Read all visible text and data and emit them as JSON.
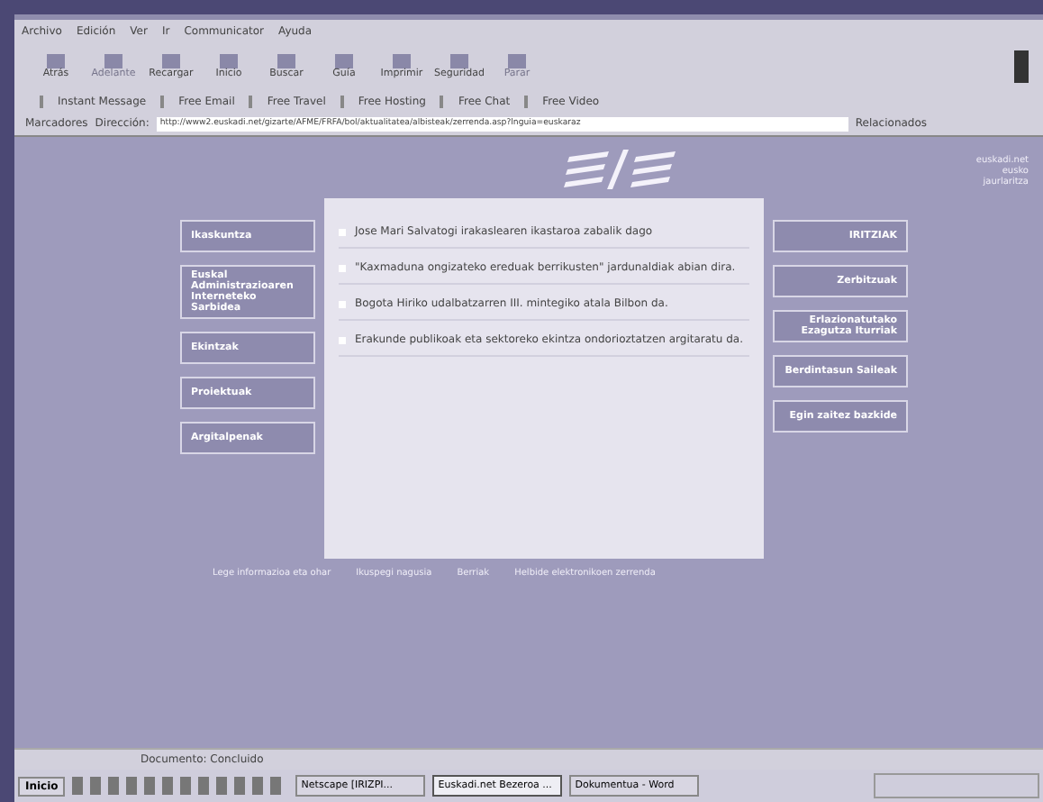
{
  "menu": [
    "Archivo",
    "Edición",
    "Ver",
    "Ir",
    "Communicator",
    "Ayuda"
  ],
  "toolbar": [
    {
      "label": "Atrás",
      "disabled": false
    },
    {
      "label": "Adelante",
      "disabled": true
    },
    {
      "label": "Recargar",
      "disabled": false
    },
    {
      "label": "Inicio",
      "disabled": false
    },
    {
      "label": "Buscar",
      "disabled": false
    },
    {
      "label": "Guía",
      "disabled": false
    },
    {
      "label": "Imprimir",
      "disabled": false
    },
    {
      "label": "Seguridad",
      "disabled": false
    },
    {
      "label": "Parar",
      "disabled": true
    }
  ],
  "personal_bar": [
    "Instant Message",
    "Free Email",
    "Free Travel",
    "Free Hosting",
    "Free Chat",
    "Free Video"
  ],
  "location": {
    "bookmarks": "Marcadores",
    "label": "Dirección:",
    "value": "http://www2.euskadi.net/gizarte/AFME/FRFA/bol/aktualitatea/albisteak/zerrenda.asp?lnguia=euskaraz",
    "related": "Relacionados"
  },
  "page": {
    "header_lines": [
      "euskadi.net",
      "eusko",
      "jaurlaritza"
    ],
    "left_menu": [
      "Ikaskuntza",
      "Euskal Administrazioaren Interneteko Sarbidea",
      "Ekintzak",
      "Proiektuak",
      "Argitalpenak"
    ],
    "right_menu": [
      "IRITZIAK",
      "Zerbitzuak",
      "Erlazionatutako Ezagutza Iturriak",
      "Berdintasun Saileak",
      "Egin zaitez bazkide"
    ],
    "news": [
      "Jose Mari Salvatogi irakaslearen ikastaroa zabalik dago",
      "\"Kaxmaduna ongizateko ereduak berrikusten\" jardunaldiak abian dira.",
      "Bogota Hiriko udalbatzarren III. mintegiko atala Bilbon da.",
      "Erakunde publikoak eta sektoreko ekintza ondorioztatzen argitaratu da."
    ],
    "footer_links": [
      "Lege informazioa eta ohar",
      "Ikuspegi nagusia",
      "Berriak",
      "Helbide elektronikoen zerrenda"
    ]
  },
  "status_bar": {
    "text": "Documento: Concluido"
  },
  "taskbar": {
    "start": "Inicio",
    "tasks": [
      {
        "label": "Netscape [IRIZPI...",
        "selected": false
      },
      {
        "label": "Euskadi.net Bezeroa ...",
        "selected": true
      },
      {
        "label": "Dokumentua - Word",
        "selected": false
      }
    ]
  }
}
